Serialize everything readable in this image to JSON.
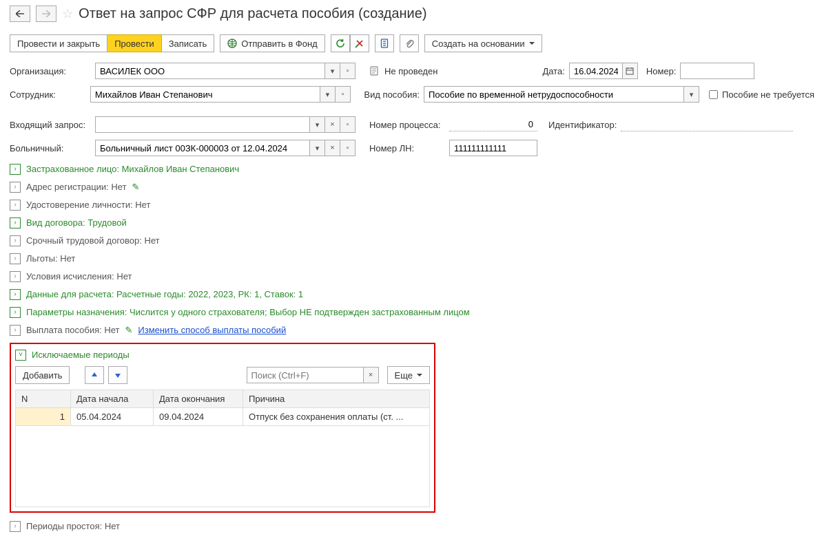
{
  "header": {
    "title": "Ответ на запрос СФР для расчета пособия (создание)"
  },
  "toolbar": {
    "post_and_close": "Провести и закрыть",
    "post": "Провести",
    "write": "Записать",
    "send_to_fund": "Отправить в Фонд",
    "create_based": "Создать на основании"
  },
  "form": {
    "org_label": "Организация:",
    "org_value": "ВАСИЛЕК ООО",
    "posted_status": "Не проведен",
    "date_label": "Дата:",
    "date_value": "16.04.2024",
    "number_label": "Номер:",
    "number_value": "",
    "employee_label": "Сотрудник:",
    "employee_value": "Михайлов Иван Степанович",
    "benefit_type_label": "Вид пособия:",
    "benefit_type_value": "Пособие по временной нетрудоспособности",
    "benefit_not_required_label": "Пособие не требуется",
    "incoming_request_label": "Входящий запрос:",
    "incoming_request_value": "",
    "process_number_label": "Номер процесса:",
    "process_number_value": "0",
    "identifier_label": "Идентификатор:",
    "identifier_value": "",
    "sick_list_label": "Больничный:",
    "sick_list_value": "Больничный лист 00ЗК-000003 от 12.04.2024",
    "ln_number_label": "Номер ЛН:",
    "ln_number_value": "111111111111"
  },
  "collapsibles": {
    "insured": "Застрахованное лицо: Михайлов Иван Степанович",
    "address": "Адрес регистрации: Нет",
    "identity": "Удостоверение личности: Нет",
    "contract_type": "Вид договора: Трудовой",
    "fixed_term": "Срочный трудовой договор: Нет",
    "benefits": "Льготы: Нет",
    "calc_conditions": "Условия исчисления: Нет",
    "calc_data": "Данные для расчета: Расчетные годы: 2022, 2023, РК: 1, Ставок: 1",
    "assign_params": "Параметры назначения: Числится у одного страхователя; Выбор НЕ подтвержден застрахованным лицом",
    "benefit_payment": "Выплата пособия: Нет",
    "change_payment_link": "Изменить способ выплаты пособий",
    "excluded_periods": "Исключаемые периоды",
    "idle_periods": "Периоды простоя: Нет"
  },
  "excluded_table": {
    "add_btn": "Добавить",
    "search_placeholder": "Поиск (Ctrl+F)",
    "more_btn": "Еще",
    "headers": {
      "n": "N",
      "start": "Дата начала",
      "end": "Дата окончания",
      "reason": "Причина"
    },
    "rows": [
      {
        "n": "1",
        "start": "05.04.2024",
        "end": "09.04.2024",
        "reason": "Отпуск без сохранения оплаты (ст. ..."
      }
    ]
  }
}
